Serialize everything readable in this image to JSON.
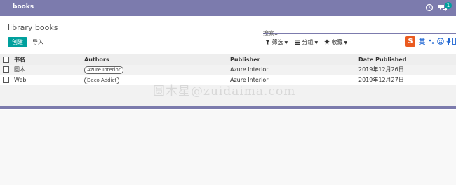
{
  "app": {
    "title": "books",
    "chat_badge": "1"
  },
  "view": {
    "breadcrumb": "library books",
    "create_label": "创建",
    "import_label": "导入",
    "search_placeholder": "搜索...",
    "filters_label": "筛选",
    "group_label": "分组",
    "favorites_label": "收藏"
  },
  "ime": {
    "logo": "S",
    "mode_label": "英"
  },
  "table": {
    "columns": [
      "书名",
      "Authors",
      "Publisher",
      "Date Published"
    ],
    "rows": [
      {
        "name": "圆木",
        "author": "Azure Interior",
        "publisher": "Azure Interior",
        "date": "2019年12月26日"
      },
      {
        "name": "Web",
        "author": "Deco Addict",
        "publisher": "Azure Interior",
        "date": "2019年12月27日"
      }
    ]
  },
  "watermark": "圆木星@zuidaima.com"
}
